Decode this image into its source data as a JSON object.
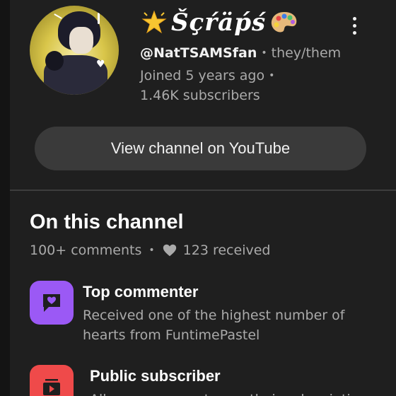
{
  "header": {
    "channel_name": "Šçŕäṕś",
    "handle": "@NatTSAMSfan",
    "separator": "•",
    "pronouns": "they/them",
    "joined": "Joined 5 years ago",
    "subscribers": "1.46K subscribers"
  },
  "actions": {
    "view_channel_label": "View channel on YouTube"
  },
  "on_this_channel": {
    "title": "On this channel",
    "comments": "100+ comments",
    "received": "123 received",
    "items": [
      {
        "title": "Top commenter",
        "description_line1": "Received one of the highest number of",
        "description_line2": "hearts from FuntimePastel",
        "icon": "comment-heart-icon",
        "color": "#9b59f5"
      },
      {
        "title": "Public subscriber",
        "description_line1": "Allows everyone to see their subscriptio",
        "icon": "subscriptions-icon",
        "color": "#ef4a4a"
      }
    ]
  },
  "colors": {
    "background": "#1f1f1f",
    "button": "#3a3a3a",
    "secondary_text": "#aaaaaa"
  }
}
